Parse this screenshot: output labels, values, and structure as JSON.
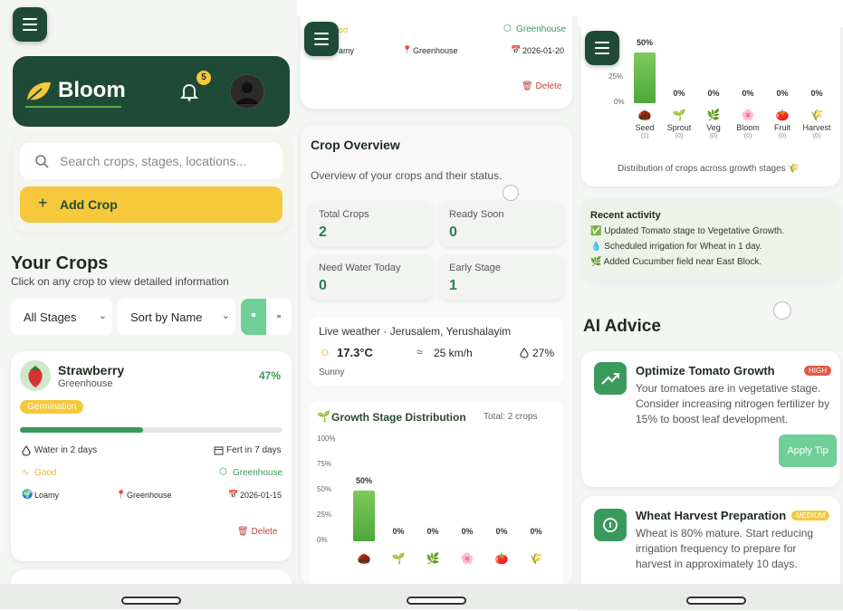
{
  "panel1": {
    "brand": "Bloom",
    "notification_count": "5",
    "search_placeholder": "Search crops, stages, locations...",
    "add_crop_label": "Add Crop",
    "your_crops_title": "Your Crops",
    "your_crops_subtitle": "Click on any crop to view detailed information",
    "filter_stage": "All Stages",
    "sort_by": "Sort by Name",
    "crop": {
      "name": "Strawberry",
      "location": "Greenhouse",
      "percent": "47%",
      "progress": 0.47,
      "stage_badge": "Germination",
      "water": "Water in 2 days",
      "fert": "Fert in 7 days",
      "health": "Good",
      "env": "Greenhouse",
      "soil": "Loamy",
      "place": "Greenhouse",
      "date": "2026-01-15",
      "delete_label": "Delete"
    }
  },
  "panel2": {
    "top_card": {
      "health": "od",
      "env": "Greenhouse",
      "soil": "amy",
      "place": "Greenhouse",
      "date": "2026-01-20",
      "delete_label": "Delete"
    },
    "overview_title": "Crop Overview",
    "overview_subtitle": "Overview of your crops and their status.",
    "stats": [
      {
        "label": "Total Crops",
        "value": "2"
      },
      {
        "label": "Ready Soon",
        "value": "0"
      },
      {
        "label": "Need Water Today",
        "value": "0"
      },
      {
        "label": "Early Stage",
        "value": "1"
      }
    ],
    "weather": {
      "title": "Live weather · Jerusalem, Yerushalayim",
      "temp": "17.3°C",
      "wind": "25 km/h",
      "humidity": "27%",
      "condition": "Sunny"
    },
    "dist_title": "Growth Stage Distribution",
    "dist_total": "Total: 2 crops"
  },
  "panel3": {
    "dist_caption": "Distribution of crops across growth stages 🌾",
    "recent_title": "Recent activity",
    "activities": [
      "✅ Updated Tomato stage to Vegetative Growth.",
      "💧 Scheduled irrigation for Wheat in 1 day.",
      "🌿 Added Cucumber field near East Block."
    ],
    "ai_title": "AI Advice",
    "advice": [
      {
        "title": "Optimize Tomato Growth",
        "priority": "HIGH",
        "lines": [
          "Your tomatoes are in vegetative stage.",
          "Consider increasing nitrogen fertilizer by",
          "15% to boost leaf development."
        ],
        "button": "Apply Tip"
      },
      {
        "title": "Wheat Harvest Preparation",
        "priority": "MEDIUM",
        "lines": [
          "Wheat is 80% mature. Start reducing",
          "irrigation frequency to prepare for",
          "harvest in approximately 10 days."
        ]
      }
    ]
  },
  "chart_data": {
    "type": "bar",
    "categories": [
      "Seed",
      "Sprout",
      "Veg",
      "Bloom",
      "Fruit",
      "Harvest"
    ],
    "category_icons": [
      "🌰",
      "🌱",
      "🌿",
      "🌸",
      "🍅",
      "🌾"
    ],
    "counts": [
      "(1)",
      "(0)",
      "(0)",
      "(0)",
      "(0)",
      "(0)"
    ],
    "values": [
      50,
      0,
      0,
      0,
      0,
      0
    ],
    "value_labels": [
      "50%",
      "0%",
      "0%",
      "0%",
      "0%",
      "0%"
    ],
    "y_ticks": [
      "100%",
      "75%",
      "50%",
      "25%",
      "0%"
    ],
    "ylim": [
      0,
      100
    ]
  },
  "colors": {
    "brand_dark": "#1f4a37",
    "accent_yellow": "#f6c83b",
    "bar_green": "#5bb046",
    "high_badge": "#e05a47",
    "medium_badge": "#f6c83b"
  }
}
